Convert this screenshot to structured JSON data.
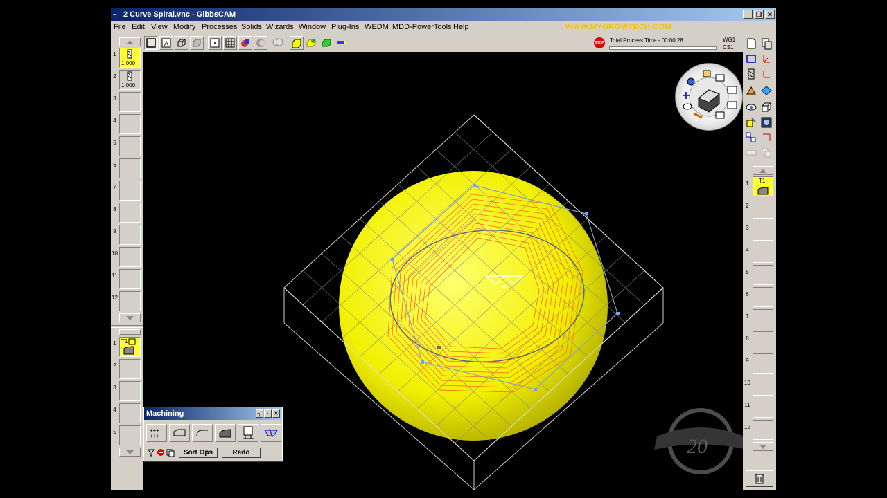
{
  "window": {
    "title": "2 Curve Spiral.vnc - GibbsCAM"
  },
  "menu": [
    "File",
    "Edit",
    "View",
    "Modify",
    "Processes",
    "Solids",
    "Wizards",
    "Window",
    "Plug-Ins",
    "WEDM",
    "MDD-PowerTools",
    "Help"
  ],
  "watermark": "WWW.MYGROWTECH.COM",
  "status": {
    "process_time": "Total Process Time - 00:00:28",
    "wg": "WG1",
    "cs": "CS1",
    "stop_label": "STOP"
  },
  "tools": {
    "slots": [
      "1",
      "2",
      "3",
      "4",
      "5",
      "6",
      "7",
      "8",
      "9",
      "10",
      "11",
      "12"
    ],
    "tool1_value": "1.000",
    "tool2_value": "1.000"
  },
  "process_list": {
    "slots": [
      "1",
      "2",
      "3",
      "4",
      "5"
    ],
    "item1_label": "T1"
  },
  "operations": {
    "slots": [
      "1",
      "2",
      "3",
      "4",
      "5",
      "6",
      "7",
      "8",
      "9",
      "10",
      "11",
      "12"
    ],
    "item1_label": "T1"
  },
  "machining_palette": {
    "title": "Machining",
    "sort_ops": "Sort Ops",
    "redo": "Redo"
  },
  "emblem_text": "20",
  "colors": {
    "accent": "#f5c400",
    "title_bar": "#0a246a",
    "sphere": "#ffff00",
    "toolpath": "#ff6a1a"
  }
}
